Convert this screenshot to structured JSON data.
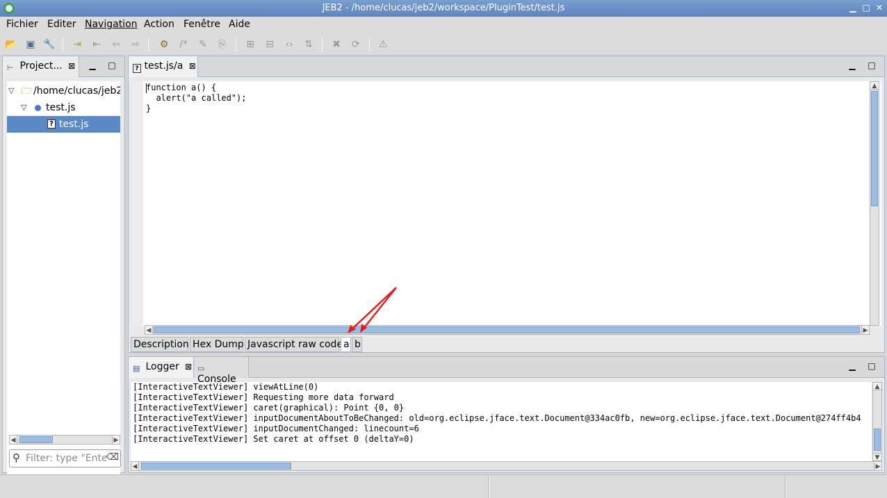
{
  "window": {
    "title": "JEB2 - /home/clucas/jeb2/workspace/PluginTest/test.js"
  },
  "menu": [
    "Fichier",
    "Editer",
    "Navigation",
    "Action",
    "Fenêtre",
    "Aide"
  ],
  "colors": {
    "titlebar": "#6a90c8",
    "selection": "#5b89c6",
    "annotation_arrow": "#e02020"
  },
  "project": {
    "tab_label": "Project...",
    "tree": [
      {
        "label": "/home/clucas/jeb2",
        "icon": "open-folder-icon"
      },
      {
        "label": "test.js",
        "icon": "artifact-dot-icon"
      },
      {
        "label": "test.js",
        "icon": "unknown-file-icon"
      }
    ],
    "filter_placeholder": "Filter: type \"Enter\""
  },
  "editor": {
    "tab_label": "test.js/a",
    "code": "function a() {\n  alert(\"a called\");\n}",
    "bottom_tabs": [
      "Description",
      "Hex Dump",
      "Javascript raw code",
      "a",
      "b"
    ],
    "selected_bottom_tab": "a"
  },
  "bottom": {
    "tabs": [
      "Logger",
      "Console"
    ],
    "log_lines": [
      "[InteractiveTextViewer] viewAtLine(0)",
      "[InteractiveTextViewer] Requesting more data forward",
      "[InteractiveTextViewer] caret(graphical): Point {0, 0}",
      "[InteractiveTextViewer] inputDocumentAboutToBeChanged: old=org.eclipse.jface.text.Document@334ac0fb, new=org.eclipse.jface.text.Document@274ff4b4",
      "[InteractiveTextViewer] inputDocumentChanged: linecount=6",
      "[InteractiveTextViewer] Set caret at offset 0 (deltaY=0)"
    ]
  },
  "icons": {
    "toolbar": [
      "open-folder-icon",
      "save-icon",
      "wrench-icon",
      "import-icon",
      "export-icon",
      "back-icon",
      "forward-icon",
      "plugins-icon",
      "comment-icon",
      "rename-icon",
      "navigate-icon",
      "grid-icon",
      "grid2-icon",
      "code-icon",
      "tree-icon",
      "delete-icon",
      "refresh-icon",
      "warning-icon"
    ]
  }
}
